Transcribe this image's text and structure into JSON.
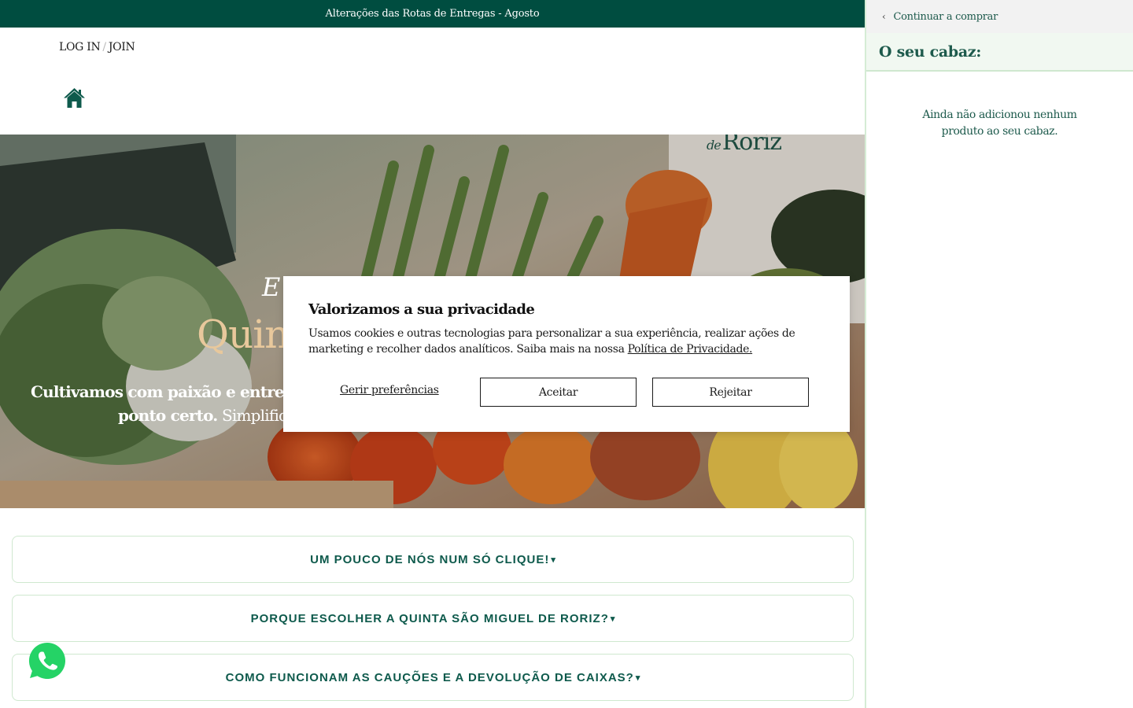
{
  "announcement": {
    "text": "Alterações das Rotas de Entregas - Agosto"
  },
  "header": {
    "login_label": "LOG IN",
    "separator": "/",
    "join_label": "JOIN",
    "home_icon": "home-icon"
  },
  "hero": {
    "logo_de": "de",
    "logo_name": "Roriz",
    "kicker": "E",
    "title": "Quin",
    "line1": "Cultivamos com paixão e entregamo",
    "line2_bold": "ponto certo.",
    "line2_rest": " Simplifique"
  },
  "accordions": [
    {
      "label": "UM POUCO DE NÓS NUM SÓ CLIQUE!",
      "caret": "▾"
    },
    {
      "label": "PORQUE ESCOLHER A QUINTA SÃO MIGUEL DE RORIZ?",
      "caret": "▾"
    },
    {
      "label": "COMO FUNCIONAM AS CAUÇÕES E A DEVOLUÇÃO DE CAIXAS?",
      "caret": "▾"
    }
  ],
  "whatsapp": {
    "icon": "whatsapp-icon",
    "color": "#25d366"
  },
  "cookie": {
    "title": "Valorizamos a sua privacidade",
    "text": "Usamos cookies e outras tecnologias para personalizar a sua experiência, realizar ações de marketing e recolher dados analíticos. Saiba mais na nossa ",
    "policy_link": "Política de Privacidade.",
    "manage_label": "Gerir preferências",
    "accept_label": "Aceitar",
    "reject_label": "Rejeitar"
  },
  "cart": {
    "back_label": "Continuar a comprar",
    "back_icon": "chevron-left-icon",
    "title": "O seu cabaz:",
    "empty_message": "Ainda não adicionou nenhum produto ao seu cabaz."
  },
  "colors": {
    "brand_dark_green": "#004d40",
    "accent_green": "#0e5a4c",
    "light_green_border": "#cfe8cf",
    "hero_title_gold": "#e8c89c"
  }
}
